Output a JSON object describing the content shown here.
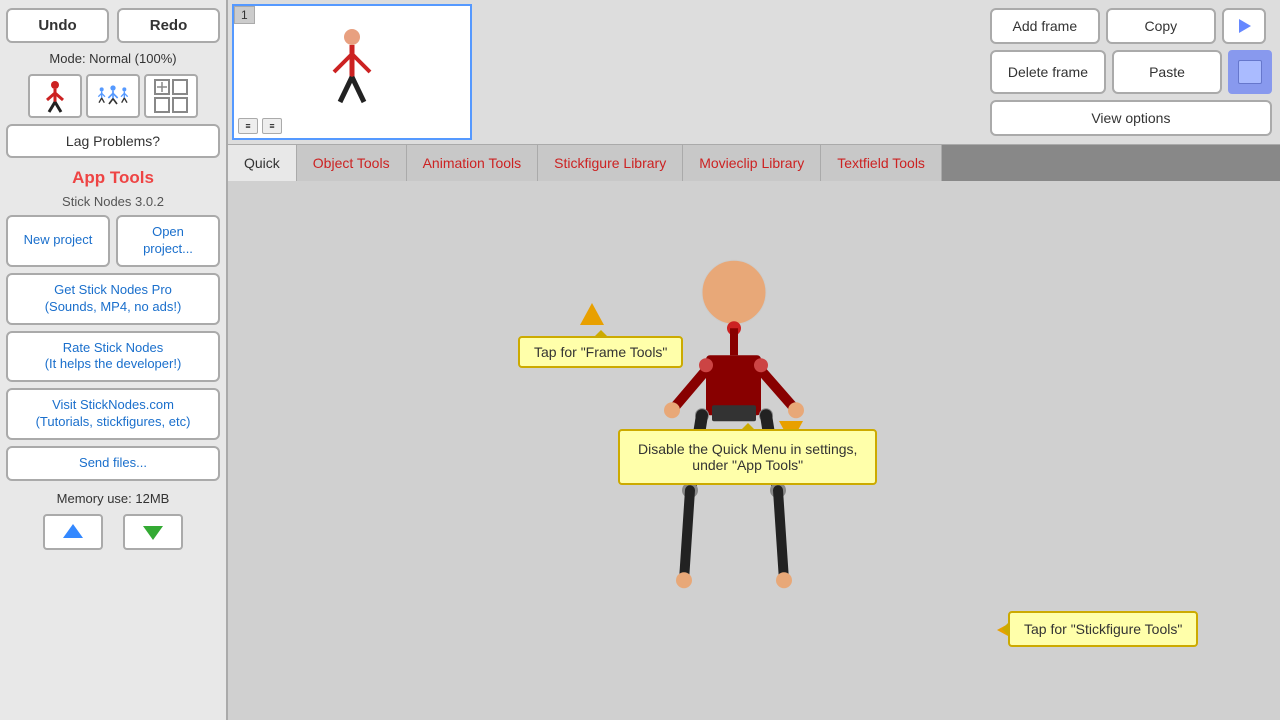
{
  "sidebar": {
    "undo_label": "Undo",
    "redo_label": "Redo",
    "mode_label": "Mode: Normal (100%)",
    "lag_label": "Lag Problems?",
    "app_tools_title": "App Tools",
    "app_tools_sub": "Stick Nodes 3.0.2",
    "new_project_label": "New project",
    "open_project_label": "Open project...",
    "get_pro_label": "Get Stick Nodes Pro\n(Sounds, MP4, no ads!)",
    "rate_label": "Rate Stick Nodes\n(It helps the developer!)",
    "visit_label": "Visit StickNodes.com\n(Tutorials, stickfigures, etc)",
    "send_files_label": "Send files...",
    "memory_label": "Memory use: 12MB"
  },
  "frame_controls": {
    "add_frame_label": "Add frame",
    "copy_label": "Copy",
    "delete_frame_label": "Delete frame",
    "paste_label": "Paste",
    "view_options_label": "View options",
    "frame_number": "1"
  },
  "nav_tabs": {
    "quick_label": "Quick",
    "object_tools_label": "Object Tools",
    "animation_tools_label": "Animation Tools",
    "stickfigure_library_label": "Stickfigure Library",
    "movieclip_library_label": "Movieclip Library",
    "textfield_tools_label": "Textfield Tools"
  },
  "tooltips": {
    "frame_tools": "Tap for \"Frame Tools\"",
    "quick_menu": "Disable the Quick Menu in settings,\nunder \"App Tools\"",
    "stickfig_tools": "Tap for \"Stickfigure Tools\""
  }
}
